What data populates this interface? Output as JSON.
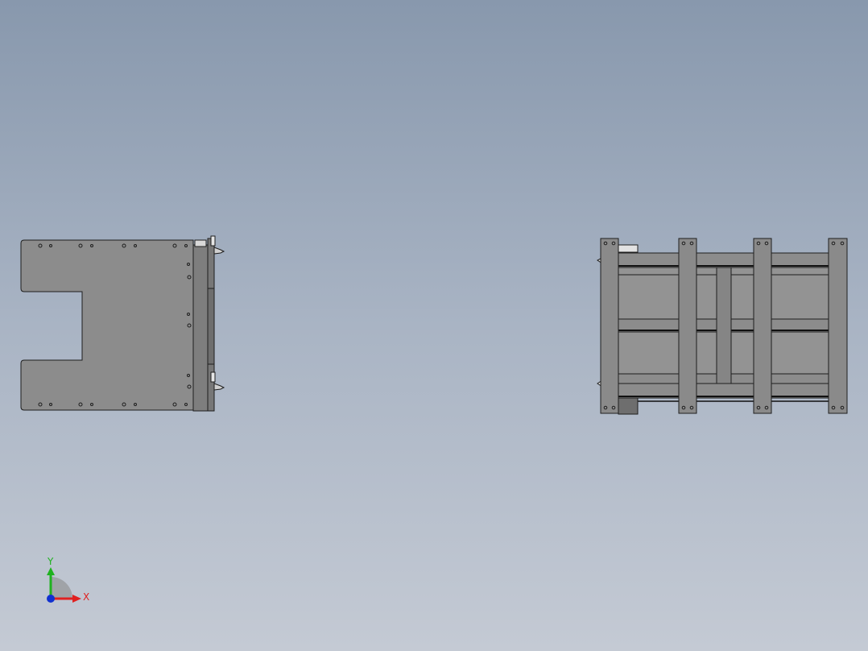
{
  "colors": {
    "background_top": "#8898ad",
    "background_bottom": "#c4cad4",
    "part_fill": "#8c8c8c",
    "part_edge": "#1e1e1e",
    "axis_x": "#e02020",
    "axis_y": "#1fb21f",
    "axis_z": "#1030d0"
  },
  "triad": {
    "x_label": "X",
    "y_label": "Y"
  }
}
